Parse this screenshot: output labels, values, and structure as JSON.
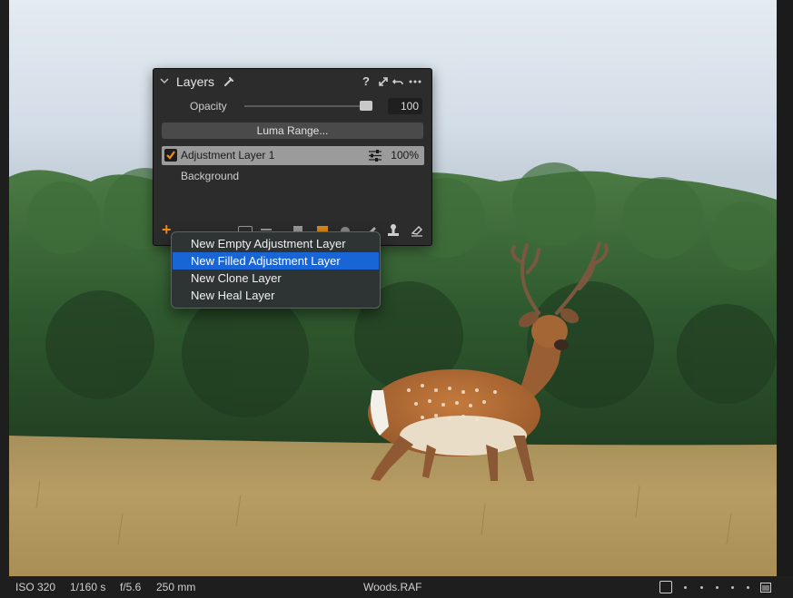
{
  "layers_panel": {
    "title": "Layers",
    "header_icons": [
      "chevron-down-icon",
      "eyedropper-icon",
      "help-icon",
      "expand-icon",
      "reset-icon",
      "more-icon"
    ],
    "help_glyph": "?",
    "opacity_label": "Opacity",
    "opacity_value": "100",
    "opacity_level": 1.0,
    "luma_range_label": "Luma Range...",
    "layers": [
      {
        "name": "Adjustment Layer 1",
        "opacity": "100%",
        "checked": true,
        "selected": true
      },
      {
        "name": "Background"
      }
    ],
    "toolbar_icons": [
      "add-layer-icon",
      "remove-layer-icon",
      "mask-icon",
      "brush-icon",
      "gradient-icon",
      "radial-icon",
      "draw-icon",
      "stamp-icon",
      "eraser-icon"
    ],
    "add_glyph": "+"
  },
  "add_layer_menu": {
    "items": [
      {
        "label": "New Empty Adjustment Layer",
        "selected": false
      },
      {
        "label": "New Filled Adjustment Layer",
        "selected": true
      },
      {
        "label": "New Clone Layer",
        "selected": false
      },
      {
        "label": "New Heal Layer",
        "selected": false
      }
    ],
    "highlight_color": "#1965d6"
  },
  "status_bar": {
    "iso": "ISO 320",
    "shutter": "1/160 s",
    "aperture": "f/5.6",
    "focal_length": "250 mm",
    "filename": "Woods.RAF"
  },
  "colors": {
    "accent": "#f08a1c",
    "panel_bg": "#2c2c2c",
    "selected_row": "#9b9b9b"
  }
}
